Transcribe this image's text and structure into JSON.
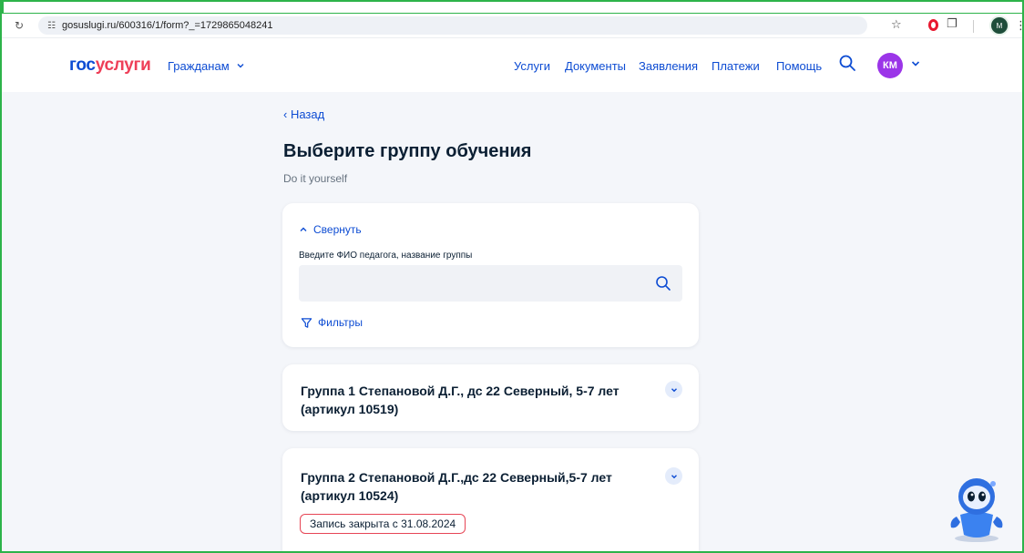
{
  "browser": {
    "site_info_icon": "tune-icon",
    "url": "gosuslugi.ru/600316/1/form?_=1729865048241",
    "profile_initial": "M"
  },
  "header": {
    "logo_part1": "гос",
    "logo_part2": "услуги",
    "citizens_label": "Гражданам",
    "nav": [
      "Услуги",
      "Документы",
      "Заявления",
      "Платежи",
      "Помощь"
    ],
    "avatar_initials": "КМ",
    "colors": {
      "brand_blue": "#0d4cd3",
      "brand_red": "#ee3f58",
      "avatar": "#9b35e8"
    }
  },
  "page": {
    "back_label": "Назад",
    "title": "Выберите группу обучения",
    "subtitle": "Do it yourself"
  },
  "search_card": {
    "collapse_label": "Свернуть",
    "input_label": "Введите ФИО педагога, название группы",
    "input_value": "",
    "input_placeholder": "",
    "filters_label": "Фильтры"
  },
  "groups": [
    {
      "line1": "Группа 1 Степановой Д.Г., дс 22 Северный, 5-7 лет",
      "line2": "(артикул 10519)"
    },
    {
      "line1": "Группа 2 Степановой Д.Г.,дс 22 Северный,5-7 лет",
      "line2": "(артикул 10524)",
      "status": "Запись закрыта с 31.08.2024"
    }
  ],
  "accent_border": "#2db34a"
}
